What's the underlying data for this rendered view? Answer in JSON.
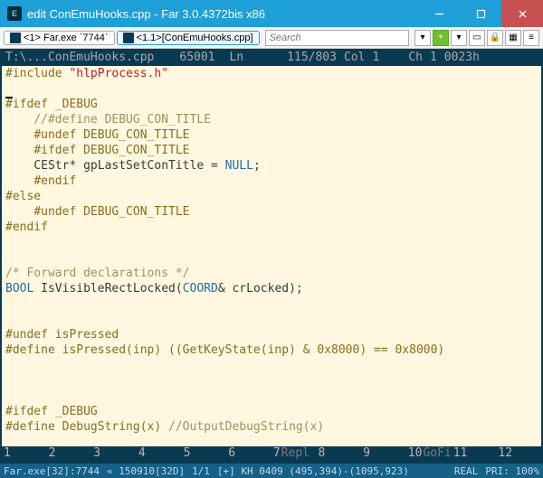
{
  "window": {
    "title": "edit ConEmuHooks.cpp - Far 3.0.4372bis x86"
  },
  "tabs": [
    {
      "label": "<1> Far.exe `7744`"
    },
    {
      "label": "<1.1>[ConEmuHooks.cpp]"
    }
  ],
  "search": {
    "placeholder": "Search"
  },
  "status_line": {
    "path": "T:\\...ConEmuHooks.cpp",
    "cp": "65001",
    "ln_label": "Ln",
    "ln": "115/803",
    "col_label": "Col",
    "col": "1",
    "ch_label": "Ch",
    "ch": "1",
    "hex": "0023h"
  },
  "code": [
    {
      "t": "pp",
      "s": "#include "
    },
    {
      "t": "str",
      "s": "\"hlpProcess.h\""
    },
    "NL",
    "NL",
    {
      "t": "pp",
      "s": "#ifdef _DEBUG"
    },
    "NL",
    {
      "t": "pad",
      "s": "    "
    },
    {
      "t": "cmt",
      "s": "//#define DEBUG_CON_TITLE"
    },
    "NL",
    {
      "t": "pad",
      "s": "    "
    },
    {
      "t": "pp",
      "s": "#undef DEBUG_CON_TITLE"
    },
    "NL",
    {
      "t": "pad",
      "s": "    "
    },
    {
      "t": "pp",
      "s": "#ifdef DEBUG_CON_TITLE"
    },
    "NL",
    {
      "t": "pad",
      "s": "    "
    },
    {
      "t": "dk",
      "s": "CEStr* gpLastSetConTitle = "
    },
    {
      "t": "blue",
      "s": "NULL"
    },
    {
      "t": "dk",
      "s": ";"
    },
    "NL",
    {
      "t": "pad",
      "s": "    "
    },
    {
      "t": "pp",
      "s": "#endif"
    },
    "NL",
    {
      "t": "pp",
      "s": "#else"
    },
    "NL",
    {
      "t": "pad",
      "s": "    "
    },
    {
      "t": "pp",
      "s": "#undef DEBUG_CON_TITLE"
    },
    "NL",
    {
      "t": "pp",
      "s": "#endif"
    },
    "NL",
    "NL",
    "NL",
    {
      "t": "cmt",
      "s": "/* Forward declarations */"
    },
    "NL",
    {
      "t": "blue",
      "s": "BOOL"
    },
    {
      "t": "dk",
      "s": " IsVisibleRectLocked("
    },
    {
      "t": "blue",
      "s": "COORD"
    },
    {
      "t": "dk",
      "s": "& crLocked);"
    },
    "NL",
    "NL",
    "NL",
    {
      "t": "pp",
      "s": "#undef isPressed"
    },
    "NL",
    {
      "t": "pp",
      "s": "#define isPressed(inp) ((GetKeyState(inp) & 0x8000) == 0x8000)"
    },
    "NL",
    "NL",
    "NL",
    "NL",
    {
      "t": "pp",
      "s": "#ifdef _DEBUG"
    },
    "NL",
    {
      "t": "pp",
      "s": "#define DebugString(x) "
    },
    {
      "t": "cmt",
      "s": "//OutputDebugString(x)"
    }
  ],
  "fkeys": [
    {
      "n": "1",
      "l": ""
    },
    {
      "n": "2",
      "l": ""
    },
    {
      "n": "3",
      "l": ""
    },
    {
      "n": "4",
      "l": ""
    },
    {
      "n": "5",
      "l": ""
    },
    {
      "n": "6",
      "l": ""
    },
    {
      "n": "7",
      "l": "Repl"
    },
    {
      "n": "8",
      "l": ""
    },
    {
      "n": "9",
      "l": ""
    },
    {
      "n": "10",
      "l": "GoFi"
    },
    {
      "n": "11",
      "l": ""
    },
    {
      "n": "12",
      "l": ""
    }
  ],
  "status": {
    "proc": "Far.exe[32]:7744",
    "win": "« 150910[32D]",
    "pos": "1/1",
    "kh": "[+] KH 0409 (495,394)-(1095,923)",
    "real": "REAL",
    "pri": "PRI: 100%"
  }
}
